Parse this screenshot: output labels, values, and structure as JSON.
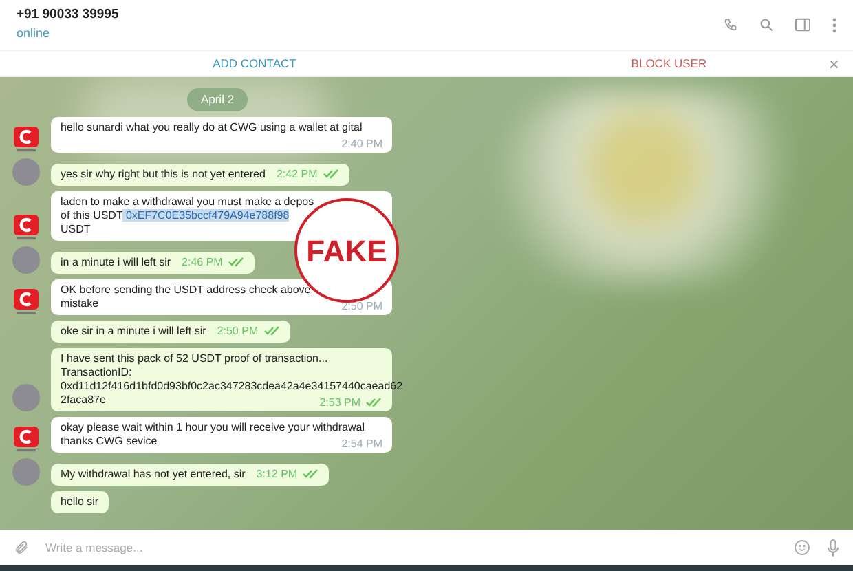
{
  "header": {
    "title": "+91 90033 39995",
    "status": "online"
  },
  "action_bar": {
    "add": "ADD CONTACT",
    "block": "BLOCK USER",
    "close": "×"
  },
  "date": "April 2",
  "messages": [
    {
      "kind": "in",
      "avatar": true,
      "lines": [
        {
          "text": "hello sunardi what you really do at CWG using a wallet at gital"
        }
      ],
      "time": "2:40 PM"
    },
    {
      "kind": "out",
      "avatar": true,
      "lines": [
        {
          "text": "yes sir why right but this is not yet entered"
        }
      ],
      "time": "2:42 PM",
      "read": true
    },
    {
      "kind": "in",
      "avatar": true,
      "lines": [
        {
          "text": "laden to make a withdrawal you must make a depos"
        },
        {
          "text": "of this USDT",
          "highlight": "0xEF7C0E35bccf479A94e788f98"
        },
        {
          "text": "USDT"
        }
      ]
    },
    {
      "kind": "out",
      "avatar": true,
      "lines": [
        {
          "text": "in a minute i will left sir"
        }
      ],
      "time": "2:46 PM",
      "read": true
    },
    {
      "kind": "in",
      "avatar": true,
      "lines": [
        {
          "text": "OK before sending the USDT address check above"
        },
        {
          "text": "mistake"
        }
      ],
      "time": "2:50 PM"
    },
    {
      "kind": "out",
      "avatar": false,
      "lines": [
        {
          "text": "oke sir in a minute i will left sir"
        }
      ],
      "time": "2:50 PM",
      "read": true
    },
    {
      "kind": "out",
      "avatar": true,
      "lines": [
        {
          "text": "I have sent this pack of 52 USDT proof of transaction..."
        },
        {
          "text": "TransactionID:"
        },
        {
          "text": "0xd11d12f416d1bfd0d93bf0c2ac347283cdea42a4e34157440caead62"
        },
        {
          "text": "2faca87e"
        }
      ],
      "time": "2:53 PM",
      "read": true
    },
    {
      "kind": "in",
      "avatar": true,
      "lines": [
        {
          "text": "okay please wait within 1 hour you will receive your withdrawal"
        },
        {
          "text": "thanks CWG sevice"
        }
      ],
      "time": "2:54 PM"
    },
    {
      "kind": "out",
      "avatar": true,
      "lines": [
        {
          "text": "My withdrawal has not yet entered, sir"
        }
      ],
      "time": "3:12 PM",
      "read": true
    },
    {
      "kind": "out",
      "avatar": false,
      "lines": [
        {
          "text": "hello sir"
        }
      ]
    }
  ],
  "stamp": "FAKE",
  "composer": {
    "placeholder": "Write a message..."
  }
}
